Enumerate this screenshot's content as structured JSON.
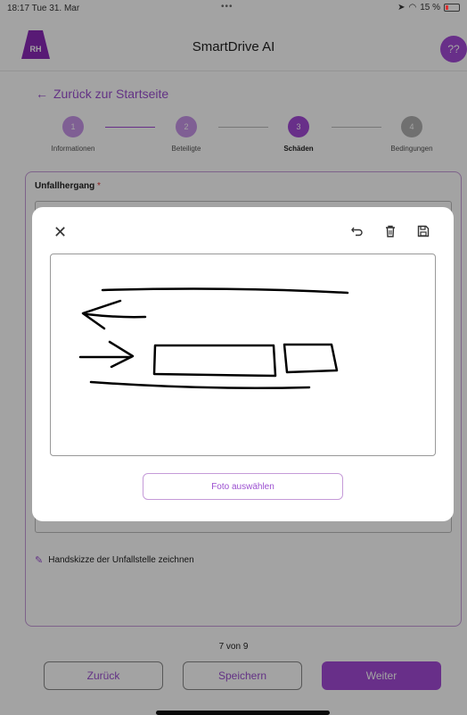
{
  "status_bar": {
    "time_date": "18:17  Tue 31. Mar",
    "dots": "•••",
    "battery_percent": "15 %"
  },
  "app": {
    "title": "SmartDrive AI",
    "logo_text": "RH",
    "help_label": "??"
  },
  "nav": {
    "back_label": "Zurück zur Startseite"
  },
  "stepper": {
    "steps": [
      {
        "number": "1",
        "label": "Informationen"
      },
      {
        "number": "2",
        "label": "Beteiligte"
      },
      {
        "number": "3",
        "label": "Schäden"
      },
      {
        "number": "4",
        "label": "Bedingungen"
      }
    ],
    "active_index": 2,
    "colors": {
      "done": "#c795e8",
      "active": "#a34ad6",
      "todo": "#b0b0b0"
    }
  },
  "form": {
    "field_label": "Unfallhergang",
    "required_mark": "*",
    "sketch_link_label": "Handskizze der Unfallstelle zeichnen"
  },
  "footer": {
    "pager_text": "7 von 9",
    "back_button": "Zurück",
    "save_button": "Speichern",
    "next_button": "Weiter"
  },
  "modal": {
    "close_icon": "close-icon",
    "photo_button": "Foto auswählen",
    "tools": [
      "undo-icon",
      "trash-icon",
      "save-icon"
    ]
  },
  "colors": {
    "accent": "#a34ad6",
    "accent_light": "#c795e8",
    "overlay": "rgba(0,0,0,0.36)"
  }
}
